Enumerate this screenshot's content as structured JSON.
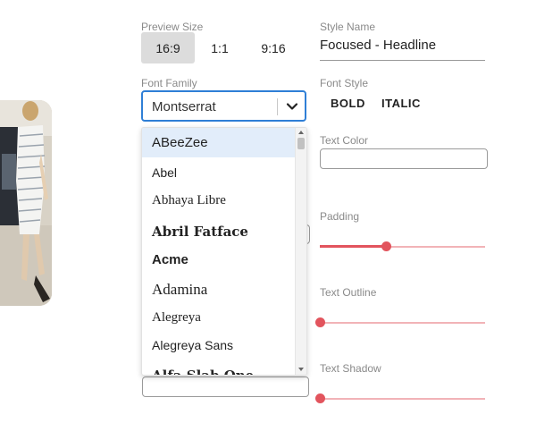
{
  "preview_size": {
    "label": "Preview Size",
    "options": [
      "16:9",
      "1:1",
      "9:16"
    ],
    "selected": "16:9"
  },
  "style_name": {
    "label": "Style Name",
    "value": "Focused - Headline"
  },
  "font_family": {
    "label": "Font Family",
    "value": "Montserrat",
    "options": [
      "ABeeZee",
      "Abel",
      "Abhaya Libre",
      "Abril Fatface",
      "Acme",
      "Adamina",
      "Alegreya",
      "Alegreya Sans",
      "Alfa Slab One"
    ],
    "highlighted": "ABeeZee"
  },
  "font_style": {
    "label": "Font Style",
    "bold_label": "BOLD",
    "italic_label": "ITALIC"
  },
  "text_color": {
    "label": "Text Color",
    "value": ""
  },
  "padding": {
    "label": "Padding",
    "level_fraction": 0.4
  },
  "text_outline": {
    "label": "Text Outline",
    "level_fraction": 0
  },
  "text_shadow": {
    "label": "Text Shadow",
    "level_fraction": 0
  },
  "colors": {
    "accent_blue": "#2f7fd6",
    "slider_red": "#e2545d",
    "slider_track": "#f2b3b7",
    "selected_option_bg": "#e2edfa",
    "active_button_bg": "#dcdcdc"
  }
}
